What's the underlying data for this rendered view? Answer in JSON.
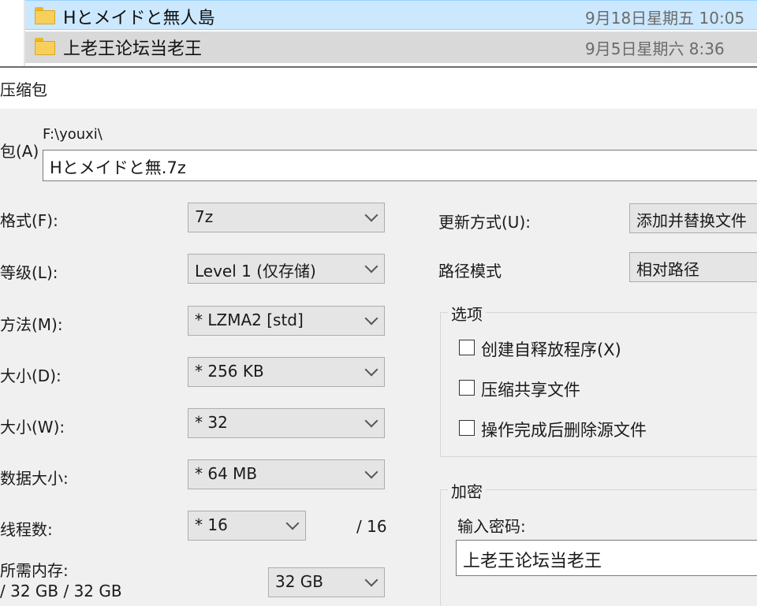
{
  "file_list": {
    "rows": [
      {
        "name": "Hとメイドと無人島",
        "date": "9月18日星期五 10:05",
        "icon": "folder-icon",
        "selected": true
      },
      {
        "name": "上老王论坛当老王",
        "date": "9月5日星期六 8:36",
        "icon": "folder-icon",
        "selected": false
      }
    ]
  },
  "dialog": {
    "title": "压缩包",
    "archive": {
      "label": "包(A)",
      "path_hint": "F:\\youxi\\",
      "value": "Hとメイドと無.7z"
    },
    "left": {
      "format": {
        "label": "格式(F):",
        "value": "7z"
      },
      "level": {
        "label": "等级(L):",
        "value": "Level 1 (仅存储)"
      },
      "method": {
        "label": "方法(M):",
        "value": "* LZMA2 [std]"
      },
      "dict": {
        "label": "大小(D):",
        "value": "* 256 KB"
      },
      "word": {
        "label": "大小(W):",
        "value": "* 32"
      },
      "solid": {
        "label": "数据大小:",
        "value": "* 64 MB"
      },
      "threads": {
        "label": "线程数:",
        "value": "* 16",
        "max": "/ 16"
      },
      "memory": {
        "label": "所需内存:",
        "detail": "/ 32 GB / 32 GB",
        "value": "32 GB"
      }
    },
    "right": {
      "update": {
        "label": "更新方式(U):",
        "value": "添加并替换文件"
      },
      "path_mode": {
        "label": "路径模式",
        "value": "相对路径"
      },
      "options": {
        "title": "选项",
        "items": [
          {
            "label": "创建自释放程序(X)",
            "checked": false
          },
          {
            "label": "压缩共享文件",
            "checked": false
          },
          {
            "label": "操作完成后删除源文件",
            "checked": false
          }
        ]
      },
      "encryption": {
        "title": "加密",
        "password_label": "输入密码:",
        "password_value": "上老王论坛当老王"
      }
    }
  }
}
